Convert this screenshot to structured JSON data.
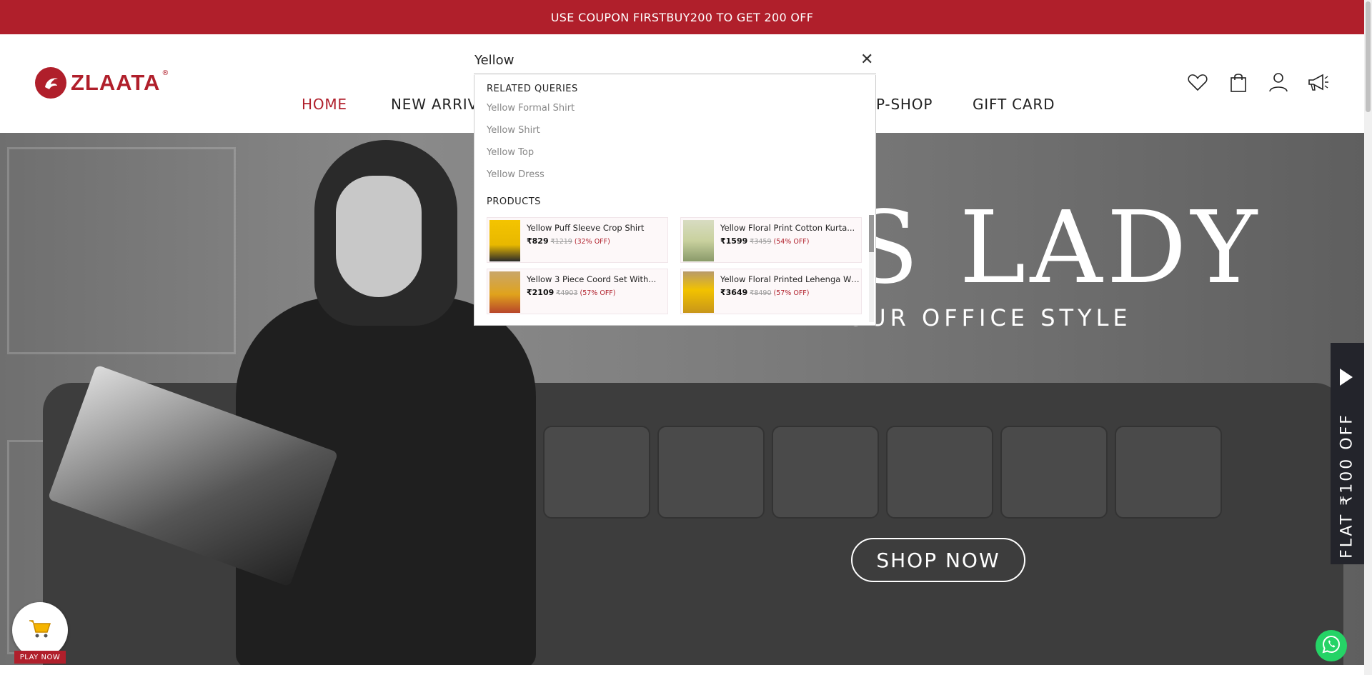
{
  "promo": {
    "text": "USE COUPON FIRSTBUY200 TO GET 200 OFF"
  },
  "brand": {
    "name": "ZLAATA",
    "reg": "®"
  },
  "nav": {
    "items": [
      {
        "label": "HOME"
      },
      {
        "label": "NEW ARRIV"
      },
      {
        "label": "P-SHOP"
      },
      {
        "label": "GIFT CARD"
      }
    ]
  },
  "header_icons": [
    "heart-icon",
    "shopping-bag-icon",
    "user-icon",
    "megaphone-icon"
  ],
  "search": {
    "value": "Yellow",
    "related_heading": "RELATED QUERIES",
    "related": [
      "Yellow Formal Shirt",
      "Yellow Shirt",
      "Yellow Top",
      "Yellow Dress"
    ],
    "products_heading": "PRODUCTS",
    "products": [
      {
        "name": "Yellow Puff Sleeve Crop Shirt",
        "price": "₹829",
        "mrp": "₹1219",
        "off": "(32% OFF)"
      },
      {
        "name": "Yellow Floral Print Cotton Kurta...",
        "price": "₹1599",
        "mrp": "₹3459",
        "off": "(54% OFF)"
      },
      {
        "name": "Yellow 3 Piece Coord Set With...",
        "price": "₹2109",
        "mrp": "₹4903",
        "off": "(57% OFF)"
      },
      {
        "name": "Yellow Floral Printed Lehenga Wit...",
        "price": "₹3649",
        "mrp": "₹8490",
        "off": "(57% OFF)"
      }
    ]
  },
  "hero": {
    "title": "S LADY",
    "subtitle": "OUR OFFICE STYLE",
    "cta": "SHOP NOW"
  },
  "flat_tab": {
    "text": "FLAT ₹100 OFF"
  },
  "play_now": {
    "label": "PLAY NOW"
  },
  "colors": {
    "brand_red": "#b01f2b",
    "whatsapp_green": "#25d366"
  }
}
